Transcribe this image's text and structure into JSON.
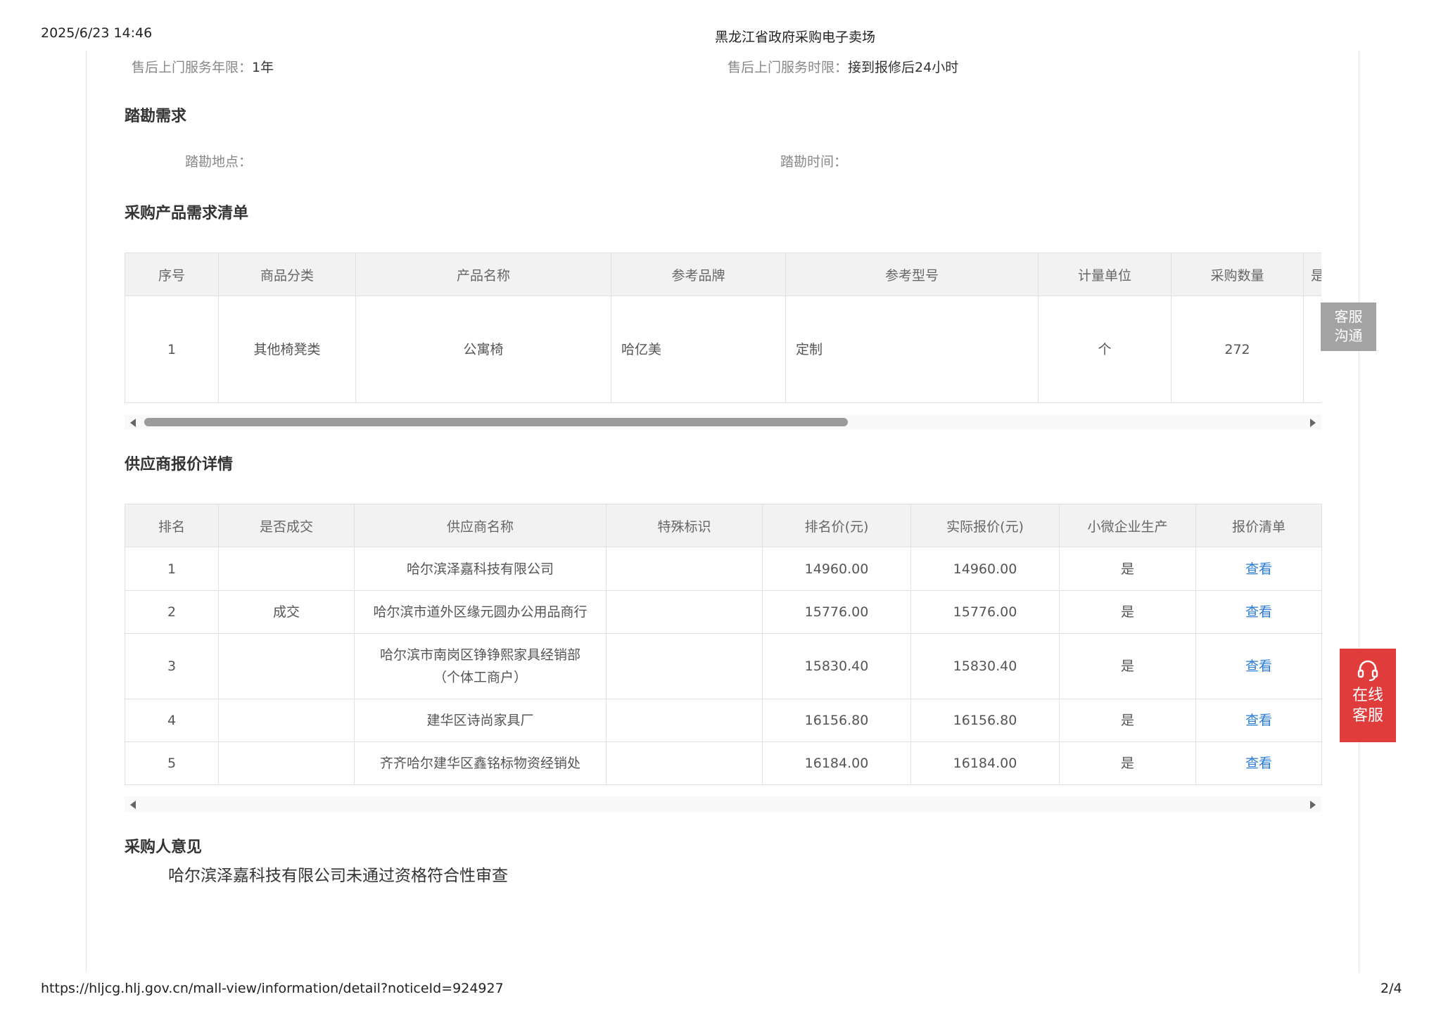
{
  "print_header": {
    "datetime": "2025/6/23 14:46",
    "title": "黑龙江省政府采购电子卖场"
  },
  "print_footer": {
    "url": "https://hljcg.hlj.gov.cn/mall-view/information/detail?noticeId=924927",
    "page": "2/4"
  },
  "after_sales": {
    "years_label": "售后上门服务年限：",
    "years_value": "1年",
    "time_label": "售后上门服务时限：",
    "time_value": "接到报修后24小时"
  },
  "survey": {
    "title": "踏勘需求",
    "location_label": "踏勘地点：",
    "location_value": "",
    "time_label": "踏勘时间：",
    "time_value": ""
  },
  "product_list": {
    "title": "采购产品需求清单",
    "headers": [
      "序号",
      "商品分类",
      "产品名称",
      "参考品牌",
      "参考型号",
      "计量单位",
      "采购数量",
      "是"
    ],
    "rows": [
      {
        "no": "1",
        "category": "其他椅凳类",
        "name": "公寓椅",
        "brand": "哈亿美",
        "model": "定制",
        "unit": "个",
        "qty": "272"
      }
    ]
  },
  "quotes": {
    "title": "供应商报价详情",
    "headers": [
      "排名",
      "是否成交",
      "供应商名称",
      "特殊标识",
      "排名价(元)",
      "实际报价(元)",
      "小微企业生产",
      "报价清单"
    ],
    "rows": [
      {
        "rank": "1",
        "deal": "",
        "supplier": "哈尔滨泽嘉科技有限公司",
        "supplier2": "",
        "flag": "",
        "rank_price": "14960.00",
        "price": "14960.00",
        "small": "是",
        "link": "查看"
      },
      {
        "rank": "2",
        "deal": "成交",
        "supplier": "哈尔滨市道外区缘元圆办公用品商行",
        "supplier2": "",
        "flag": "",
        "rank_price": "15776.00",
        "price": "15776.00",
        "small": "是",
        "link": "查看"
      },
      {
        "rank": "3",
        "deal": "",
        "supplier": "哈尔滨市南岗区铮铮熙家具经销部",
        "supplier2": "（个体工商户）",
        "flag": "",
        "rank_price": "15830.40",
        "price": "15830.40",
        "small": "是",
        "link": "查看"
      },
      {
        "rank": "4",
        "deal": "",
        "supplier": "建华区诗尚家具厂",
        "supplier2": "",
        "flag": "",
        "rank_price": "16156.80",
        "price": "16156.80",
        "small": "是",
        "link": "查看"
      },
      {
        "rank": "5",
        "deal": "",
        "supplier": "齐齐哈尔建华区鑫铭标物资经销处",
        "supplier2": "",
        "flag": "",
        "rank_price": "16184.00",
        "price": "16184.00",
        "small": "是",
        "link": "查看"
      }
    ]
  },
  "buyer_opinion": {
    "title": "采购人意见",
    "text": "哈尔滨泽嘉科技有限公司未通过资格符合性审查"
  },
  "widgets": {
    "kefu_grey_line1": "客服",
    "kefu_grey_line2": "沟通",
    "kefu_red_line1": "在线",
    "kefu_red_line2": "客服",
    "headset_icon": "headset-icon"
  },
  "colors": {
    "link": "#2a7bd4",
    "kefu_red": "#e13c3c",
    "kefu_grey": "#a3a3a3",
    "header_bg": "#f2f2f2"
  }
}
